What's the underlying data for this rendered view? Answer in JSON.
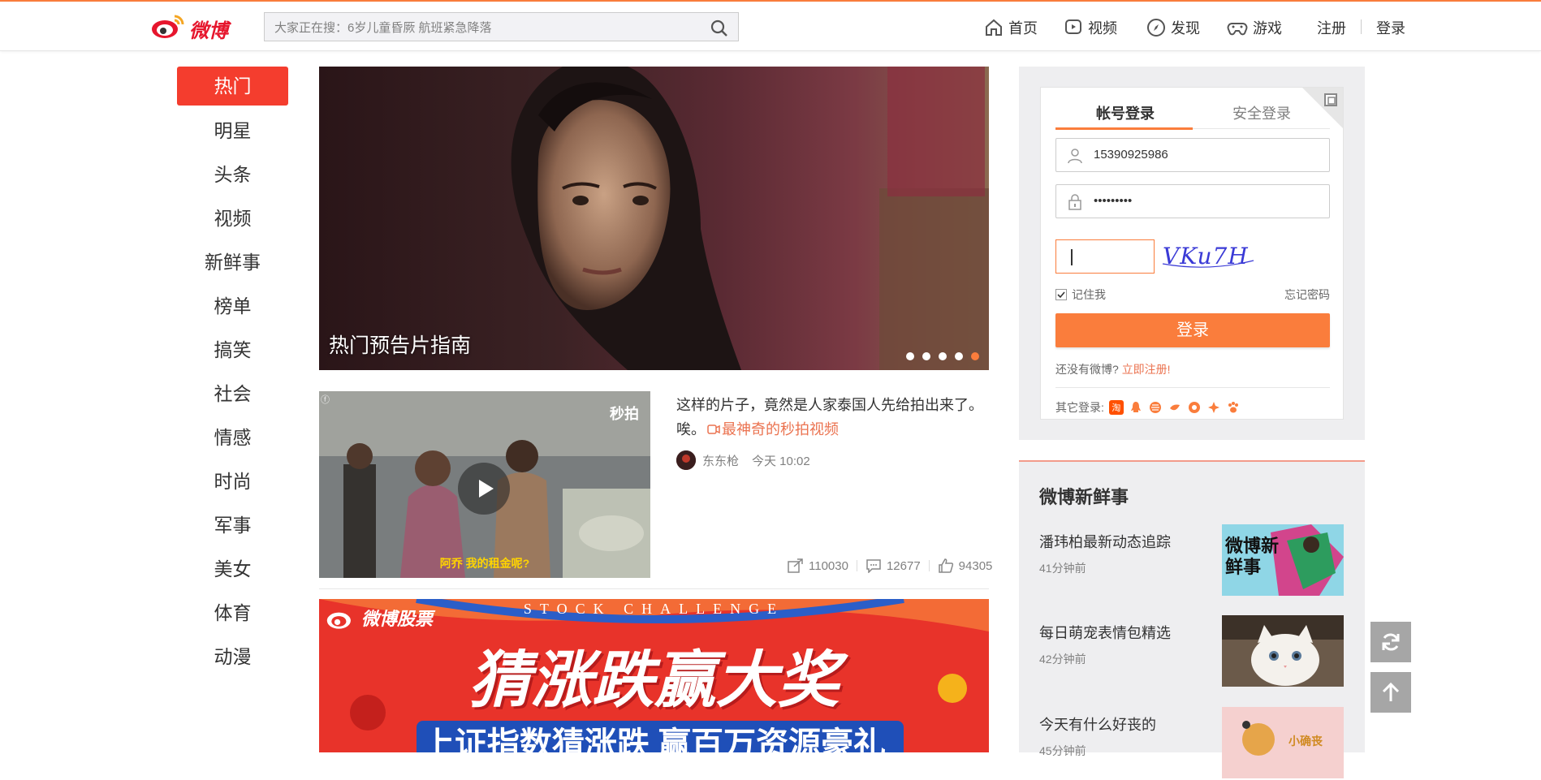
{
  "header": {
    "logo_text": "微博",
    "search_placeholder": "大家正在搜：6岁儿童昏厥 航班紧急降落",
    "nav": {
      "home": "首页",
      "video": "视频",
      "discover": "发现",
      "games": "游戏",
      "register": "注册",
      "login": "登录"
    }
  },
  "sidebar": {
    "items": [
      "热门",
      "明星",
      "头条",
      "视频",
      "新鲜事",
      "榜单",
      "搞笑",
      "社会",
      "情感",
      "时尚",
      "军事",
      "美女",
      "体育",
      "动漫"
    ]
  },
  "hero": {
    "title": "热门预告片指南",
    "slides": 5,
    "active_slide": 5
  },
  "feed": {
    "text": "这样的片子，竟然是人家泰国人先给拍出来了。唉。",
    "link": "最神奇的秒拍视频",
    "author": "东东枪",
    "time": "今天 10:02",
    "video_caption": "阿乔 我的租金呢?",
    "video_watermark": "秒拍",
    "shares": "110030",
    "comments": "12677",
    "likes": "94305"
  },
  "banner": {
    "brand": "微博股票",
    "tagline": "STOCK CHALLENGE",
    "headline": "猜涨跌赢大奖",
    "subline": "上证指数猜涨跌 赢百万资源豪礼"
  },
  "login": {
    "tab_account": "帐号登录",
    "tab_secure": "安全登录",
    "username": "15390925986",
    "password": "•••••••••",
    "captcha_text": "VKu7H",
    "remember": "记住我",
    "forgot": "忘记密码",
    "submit": "登录",
    "no_account": "还没有微博?",
    "register_now": "立即注册!",
    "other_login": "其它登录:",
    "colors": {
      "accent": "#fa7d3c",
      "link": "#eb7350",
      "hot": "#f43d2e"
    }
  },
  "fresh": {
    "title": "微博新鲜事",
    "items": [
      {
        "title": "潘玮柏最新动态追踪",
        "time": "41分钟前",
        "thumb_text": "微博新鲜事"
      },
      {
        "title": "每日萌宠表情包精选",
        "time": "42分钟前"
      },
      {
        "title": "今天有什么好丧的",
        "time": "45分钟前",
        "thumb_text": "小确丧"
      }
    ]
  }
}
